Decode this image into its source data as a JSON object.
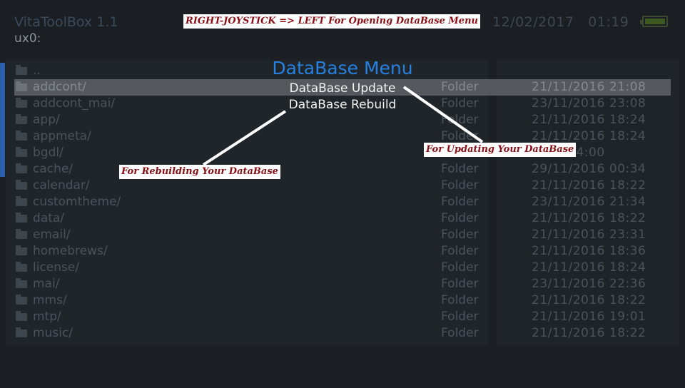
{
  "header": {
    "app_title": "VitaToolBox 1.1",
    "current_path": "ux0:",
    "date": "12/02/2017",
    "time": "01:19"
  },
  "annotations": {
    "top_note": "RIGHT-JOYSTICK => LEFT For Opening DataBase Menu",
    "update_note": "For Updating Your DataBase",
    "rebuild_note": "For Rebuilding Your DataBase"
  },
  "menu": {
    "title": "DataBase Menu",
    "items": [
      "DataBase Update",
      "DataBase Rebuild"
    ]
  },
  "files": [
    {
      "name": "..",
      "type": "",
      "date": ""
    },
    {
      "name": "addcont/",
      "type": "Folder",
      "date": "21/11/2016 21:08"
    },
    {
      "name": "addcont_mai/",
      "type": "Folder",
      "date": "23/11/2016 23:08"
    },
    {
      "name": "app/",
      "type": "Folder",
      "date": "21/11/2016 18:24"
    },
    {
      "name": "appmeta/",
      "type": "Folder",
      "date": "21/11/2016 18:24"
    },
    {
      "name": "bgdl/",
      "type": "Folder",
      "date": "2016 04:00"
    },
    {
      "name": "cache/",
      "type": "Folder",
      "date": "29/11/2016 00:34"
    },
    {
      "name": "calendar/",
      "type": "Folder",
      "date": "21/11/2016 18:22"
    },
    {
      "name": "customtheme/",
      "type": "Folder",
      "date": "23/11/2016 21:34"
    },
    {
      "name": "data/",
      "type": "Folder",
      "date": "21/11/2016 18:22"
    },
    {
      "name": "email/",
      "type": "Folder",
      "date": "21/11/2016 23:31"
    },
    {
      "name": "homebrews/",
      "type": "Folder",
      "date": "21/11/2016 18:36"
    },
    {
      "name": "license/",
      "type": "Folder",
      "date": "21/11/2016 18:24"
    },
    {
      "name": "mai/",
      "type": "Folder",
      "date": "23/11/2016 22:36"
    },
    {
      "name": "mms/",
      "type": "Folder",
      "date": "21/11/2016 18:22"
    },
    {
      "name": "mtp/",
      "type": "Folder",
      "date": "21/11/2016 19:01"
    },
    {
      "name": "music/",
      "type": "Folder",
      "date": "21/11/2016 18:22"
    }
  ],
  "selected_index": 1,
  "colors": {
    "menu_title": "#2680e0",
    "annotation_text": "#8a0f16",
    "battery": "#3c5a20"
  }
}
